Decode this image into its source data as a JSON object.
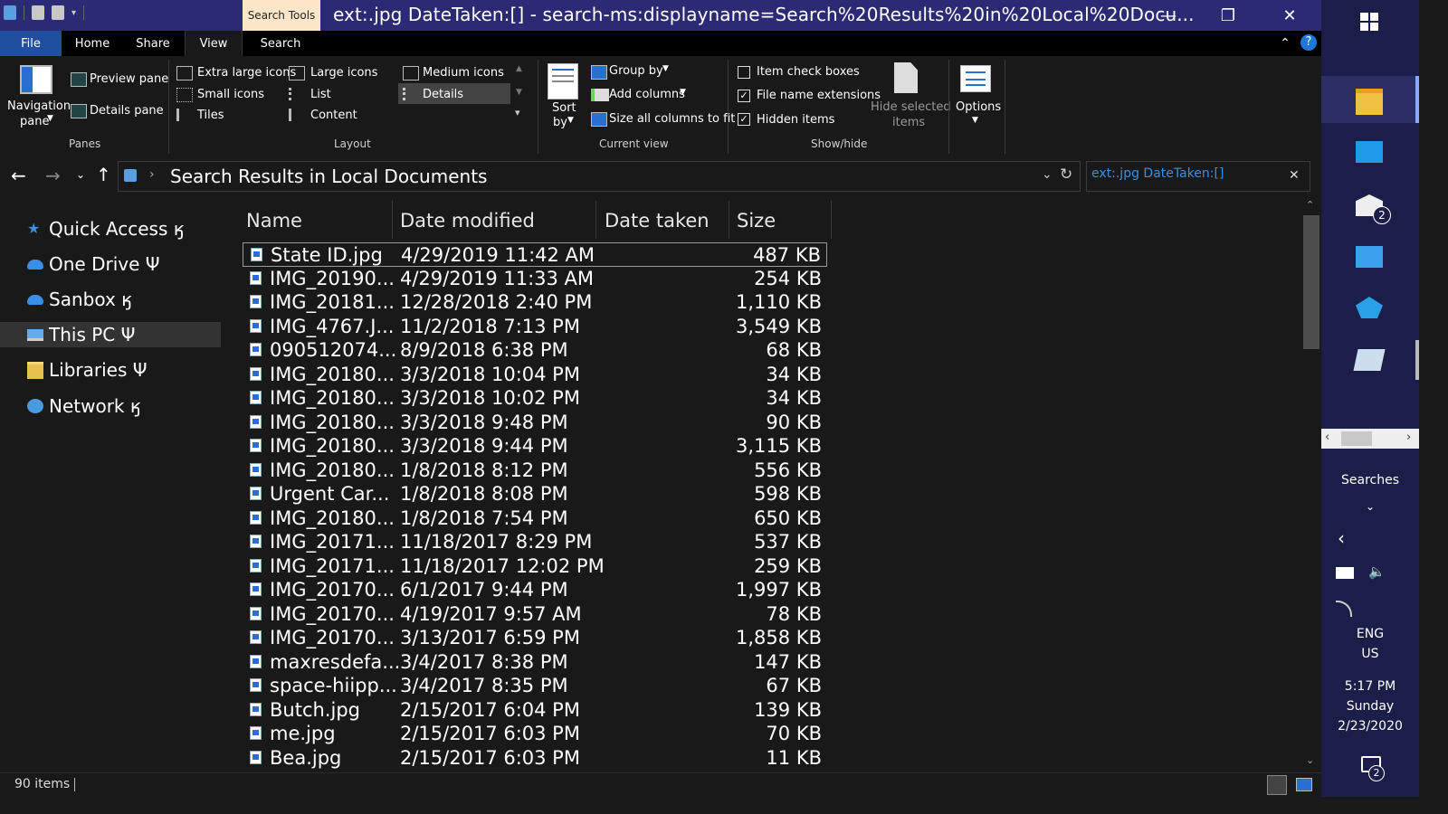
{
  "titlebar": {
    "context_tab": "Search Tools",
    "title": "ext:.jpg DateTaken:[] - search-ms:displayname=Search%20Results%20in%20Local%20Docu...",
    "minimize": "—",
    "maximize": "❐",
    "close": "✕"
  },
  "ribbon_tabs": [
    "File",
    "Home",
    "Share",
    "View",
    "Search"
  ],
  "ribbon": {
    "panes": {
      "navigation_pane_line1": "Navigation",
      "navigation_pane_line2": "pane",
      "preview_pane": "Preview pane",
      "details_pane": "Details pane",
      "group_label": "Panes"
    },
    "layout": {
      "extra_large_icons": "Extra large icons",
      "large_icons": "Large icons",
      "medium_icons": "Medium icons",
      "small_icons": "Small icons",
      "list": "List",
      "details": "Details",
      "tiles": "Tiles",
      "content": "Content",
      "group_label": "Layout"
    },
    "current_view": {
      "sort_by_line1": "Sort",
      "sort_by_line2": "by",
      "group_by": "Group by",
      "add_columns": "Add columns",
      "size_all_columns": "Size all columns to fit",
      "group_label": "Current view"
    },
    "show_hide": {
      "item_check_boxes": "Item check boxes",
      "item_check_boxes_checked": false,
      "file_name_extensions": "File name extensions",
      "file_name_extensions_checked": true,
      "hidden_items": "Hidden items",
      "hidden_items_checked": true,
      "hide_selected_line1": "Hide selected",
      "hide_selected_line2": "items",
      "group_label": "Show/hide"
    },
    "options": "Options"
  },
  "address": {
    "path": "Search Results in Local Documents",
    "search_query": "ext:.jpg DateTaken:[]"
  },
  "nav": [
    {
      "label": "Quick Access ӄ",
      "icon": "star-icon",
      "color": "#3a8ee6"
    },
    {
      "label": "One Drive Ψ",
      "icon": "cloud-icon",
      "color": "#3a8ee6"
    },
    {
      "label": "Sanbox ӄ",
      "icon": "cloud-icon",
      "color": "#3a8ee6"
    },
    {
      "label": "This PC Ψ",
      "icon": "computer-icon",
      "color": "#6aa8e8"
    },
    {
      "label": "Libraries Ψ",
      "icon": "folder-icon",
      "color": "#e8c050"
    },
    {
      "label": "Network ӄ",
      "icon": "network-icon",
      "color": "#4a9ae0"
    }
  ],
  "columns": {
    "name": "Name",
    "date_modified": "Date modified",
    "date_taken": "Date taken",
    "size": "Size"
  },
  "files": [
    {
      "name": "State ID.jpg",
      "modified": "4/29/2019 11:42 AM",
      "size": "487 KB"
    },
    {
      "name": "IMG_20190...",
      "modified": "4/29/2019 11:33 AM",
      "size": "254 KB"
    },
    {
      "name": "IMG_20181...",
      "modified": "12/28/2018 2:40 PM",
      "size": "1,110 KB"
    },
    {
      "name": "IMG_4767.J...",
      "modified": "11/2/2018 7:13 PM",
      "size": "3,549 KB"
    },
    {
      "name": "090512074...",
      "modified": "8/9/2018 6:38 PM",
      "size": "68 KB"
    },
    {
      "name": "IMG_20180...",
      "modified": "3/3/2018 10:04 PM",
      "size": "34 KB"
    },
    {
      "name": "IMG_20180...",
      "modified": "3/3/2018 10:02 PM",
      "size": "34 KB"
    },
    {
      "name": "IMG_20180...",
      "modified": "3/3/2018 9:48 PM",
      "size": "90 KB"
    },
    {
      "name": "IMG_20180...",
      "modified": "3/3/2018 9:44 PM",
      "size": "3,115 KB"
    },
    {
      "name": "IMG_20180...",
      "modified": "1/8/2018 8:12 PM",
      "size": "556 KB"
    },
    {
      "name": "Urgent Car...",
      "modified": "1/8/2018 8:08 PM",
      "size": "598 KB"
    },
    {
      "name": "IMG_20180...",
      "modified": "1/8/2018 7:54 PM",
      "size": "650 KB"
    },
    {
      "name": "IMG_20171...",
      "modified": "11/18/2017 8:29 PM",
      "size": "537 KB"
    },
    {
      "name": "IMG_20171...",
      "modified": "11/18/2017 12:02 PM",
      "size": "259 KB"
    },
    {
      "name": "IMG_20170...",
      "modified": "6/1/2017 9:44 PM",
      "size": "1,997 KB"
    },
    {
      "name": "IMG_20170...",
      "modified": "4/19/2017 9:57 AM",
      "size": "78 KB"
    },
    {
      "name": "IMG_20170...",
      "modified": "3/13/2017 6:59 PM",
      "size": "1,858 KB"
    },
    {
      "name": "maxresdefa...",
      "modified": "3/4/2017 8:38 PM",
      "size": "147 KB"
    },
    {
      "name": "space-hiipp...",
      "modified": "3/4/2017 8:35 PM",
      "size": "67 KB"
    },
    {
      "name": "Butch.jpg",
      "modified": "2/15/2017 6:04 PM",
      "size": "139 KB"
    },
    {
      "name": "me.jpg",
      "modified": "2/15/2017 6:03 PM",
      "size": "70 KB"
    },
    {
      "name": "Bea.jpg",
      "modified": "2/15/2017 6:03 PM",
      "size": "11 KB"
    }
  ],
  "status": {
    "item_count": "90 items"
  },
  "taskbar": {
    "searches_label": "Searches",
    "mail_badge": "2",
    "language_line1": "ENG",
    "language_line2": "US",
    "time": "5:17 PM",
    "day": "Sunday",
    "date": "2/23/2020",
    "notification_badge": "2"
  },
  "colors": {
    "titlebar": "#2b2b75",
    "file_tab": "#1f4f9e",
    "search_tools": "#fbe6c8",
    "taskbar": "#1c1e4a",
    "search_text": "#3b8fe0"
  }
}
